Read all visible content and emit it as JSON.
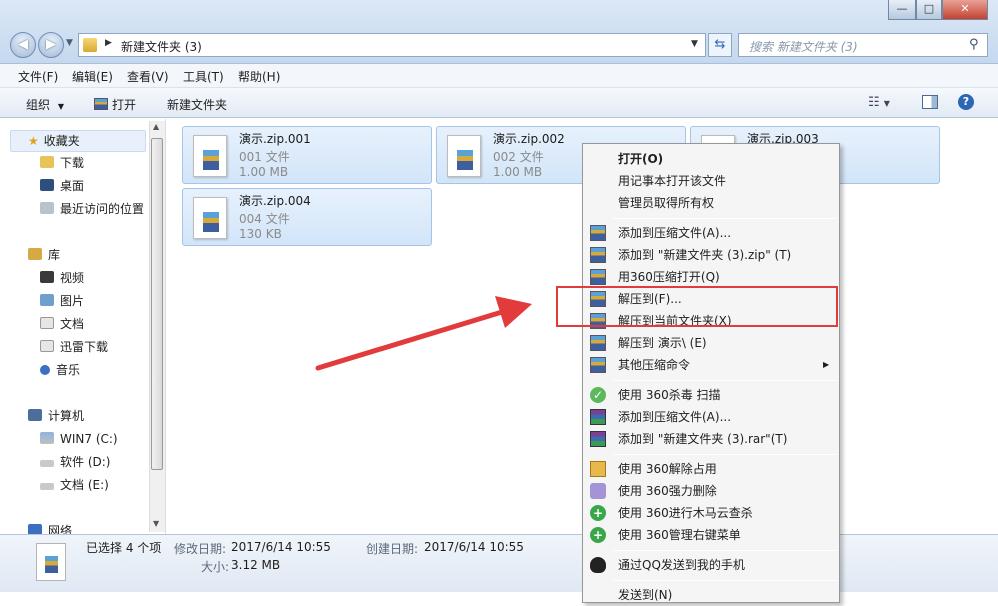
{
  "window": {
    "address": "新建文件夹 (3)",
    "search_placeholder": "搜索 新建文件夹 (3)",
    "btn_min": "—",
    "btn_max": "□",
    "btn_close": "✕"
  },
  "menubar": [
    "文件(F)",
    "编辑(E)",
    "查看(V)",
    "工具(T)",
    "帮助(H)"
  ],
  "toolbar": {
    "organize": "组织",
    "open": "打开",
    "new_folder": "新建文件夹"
  },
  "nav": {
    "favorites": "收藏夹",
    "fav_items": [
      "下载",
      "桌面",
      "最近访问的位置"
    ],
    "library": "库",
    "lib_items": [
      "视频",
      "图片",
      "文档",
      "迅雷下载",
      "音乐"
    ],
    "computer": "计算机",
    "drives": [
      "WIN7 (C:)",
      "软件 (D:)",
      "文档 (E:)"
    ],
    "network": "网络"
  },
  "files": [
    {
      "name": "演示.zip.001",
      "type": "001 文件",
      "size": "1.00 MB"
    },
    {
      "name": "演示.zip.002",
      "type": "002 文件",
      "size": "1.00 MB"
    },
    {
      "name": "演示.zip.003",
      "type": "",
      "size": ""
    },
    {
      "name": "演示.zip.004",
      "type": "004 文件",
      "size": "130 KB"
    }
  ],
  "details": {
    "selected": "已选择 4 个项",
    "modified_label": "修改日期:",
    "modified": "2017/6/14 10:55",
    "created_label": "创建日期:",
    "created": "2017/6/14 10:55",
    "size_label": "大小:",
    "size": "3.12 MB"
  },
  "context_menu": {
    "items": [
      "打开(O)",
      "用记事本打开该文件",
      "管理员取得所有权",
      "添加到压缩文件(A)...",
      "添加到 \"新建文件夹 (3).zip\" (T)",
      "用360压缩打开(Q)",
      "解压到(F)...",
      "解压到当前文件夹(X)",
      "解压到 演示\\ (E)",
      "其他压缩命令",
      "使用 360杀毒 扫描",
      "添加到压缩文件(A)...",
      "添加到 \"新建文件夹 (3).rar\"(T)",
      "使用 360解除占用",
      "使用 360强力删除",
      "使用 360进行木马云查杀",
      "使用 360管理右键菜单",
      "通过QQ发送到我的手机",
      "发送到(N)"
    ]
  },
  "colors": {
    "highlight_box": "#e23b3b",
    "arrow": "#e23b3b"
  }
}
